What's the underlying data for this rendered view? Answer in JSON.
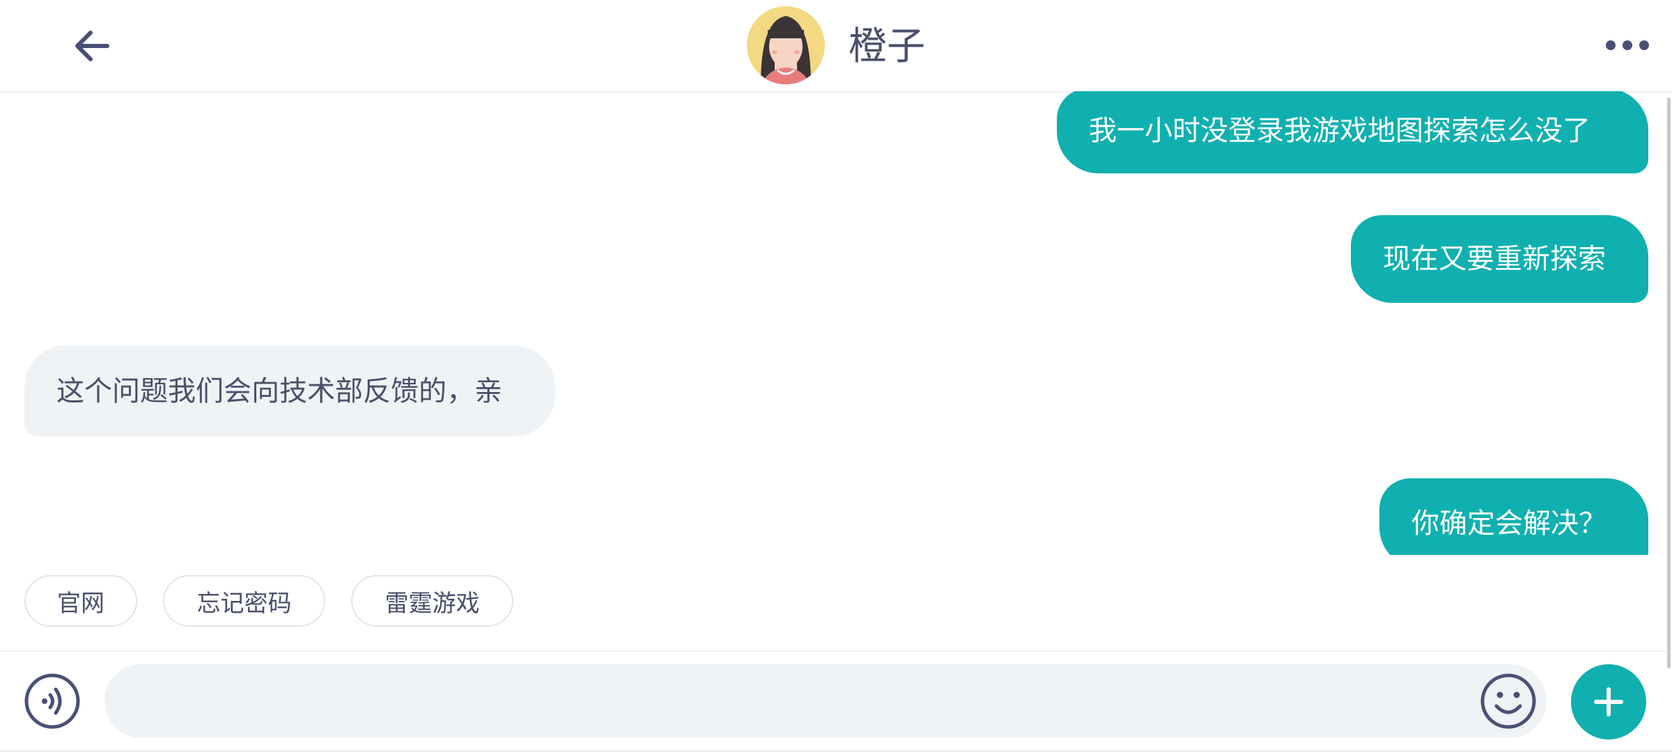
{
  "header": {
    "back_icon": "arrow-left-icon",
    "contact_name": "橙子",
    "avatar": "avatar-girl-icon",
    "more_icon": "more-horizontal-icon"
  },
  "messages": [
    {
      "direction": "out",
      "text": "我一小时没登录我游戏地图探索怎么没了"
    },
    {
      "direction": "out",
      "text": "现在又要重新探索"
    },
    {
      "direction": "in",
      "text": "这个问题我们会向技术部反馈的，亲"
    },
    {
      "direction": "out",
      "text": "你确定会解决？"
    }
  ],
  "quick_replies": [
    "官网",
    "忘记密码",
    "雷霆游戏"
  ],
  "input_bar": {
    "voice_icon": "voice-icon",
    "message_value": "",
    "emoji_icon": "emoji-icon",
    "plus_icon": "plus-icon"
  },
  "colors": {
    "accent": "#0fb0af",
    "incoming_bubble": "#f0f3f6",
    "text": "#4a4f6b",
    "icon": "#4a5075"
  }
}
